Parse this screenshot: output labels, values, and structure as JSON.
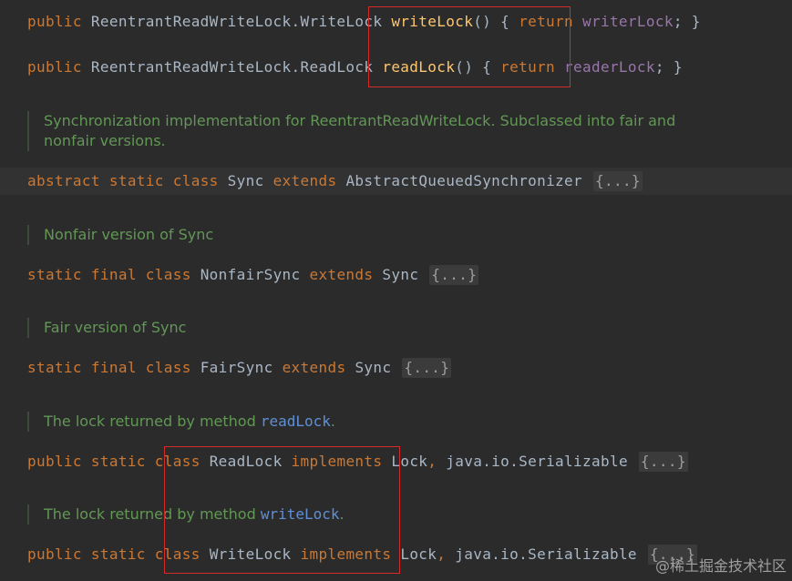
{
  "lines": {
    "write_lock": {
      "public": "public",
      "type": "ReentrantReadWriteLock.WriteLock",
      "method": "writeLock",
      "parens": "() {",
      "return": "return",
      "field": "writerLock",
      "end": "; }"
    },
    "read_lock": {
      "public": "public",
      "type": "ReentrantReadWriteLock.ReadLock",
      "method": "readLock",
      "parens": "() {",
      "return": "return",
      "field": "readerLock",
      "end": "; }"
    },
    "sync_doc": "Synchronization implementation for ReentrantReadWriteLock. Subclassed into fair and nonfair versions.",
    "sync": {
      "abstract": "abstract",
      "static": "static",
      "class": "class",
      "name": "Sync",
      "extends": "extends",
      "parent": "AbstractQueuedSynchronizer",
      "fold": "{...}"
    },
    "nonfair_doc": "Nonfair version of Sync",
    "nonfair": {
      "static": "static",
      "final": "final",
      "class": "class",
      "name": "NonfairSync",
      "extends": "extends",
      "parent": "Sync",
      "fold": "{...}"
    },
    "fair_doc": "Fair version of Sync",
    "fair": {
      "static": "static",
      "final": "final",
      "class": "class",
      "name": "FairSync",
      "extends": "extends",
      "parent": "Sync",
      "fold": "{...}"
    },
    "readlock_doc": {
      "text": "The lock returned by method",
      "link": "readLock",
      "end": "."
    },
    "readlock_class": {
      "public": "public",
      "static": "static",
      "class": "class",
      "name": "ReadLock",
      "implements": "implements",
      "iface": "Lock",
      "comma": ",",
      "serial": "java.io.Serializable",
      "fold": "{...}"
    },
    "writelock_doc": {
      "text": "The lock returned by method",
      "link": "writeLock",
      "end": "."
    },
    "writelock_class": {
      "public": "public",
      "static": "static",
      "class": "class",
      "name": "WriteLock",
      "implements": "implements",
      "iface": "Lock",
      "comma": ",",
      "serial": "java.io.Serializable",
      "fold": "{...}"
    }
  },
  "watermark": "@稀土掘金技术社区",
  "colors": {
    "background": "#2b2b2b",
    "keyword": "#cc7832",
    "method": "#ffc66d",
    "field": "#9876aa",
    "plain": "#a9b7c6",
    "doc": "#629755",
    "doc_link": "#5f8fd6",
    "annotation_box": "#d42a2a"
  }
}
